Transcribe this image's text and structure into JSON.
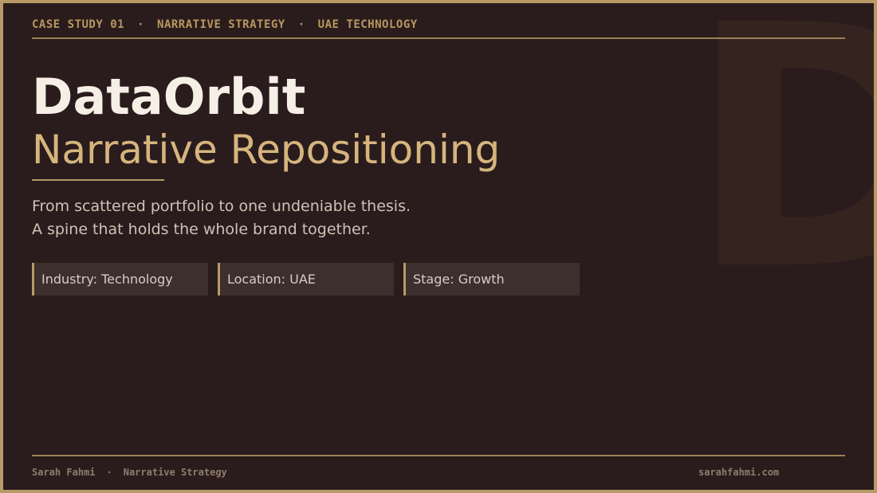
{
  "watermark": {
    "letter": "D"
  },
  "header": {
    "items": [
      "CASE STUDY 01",
      "NARRATIVE STRATEGY",
      "UAE TECHNOLOGY"
    ],
    "separator": "·"
  },
  "hero": {
    "title": "DataOrbit",
    "subtitle": "Narrative Repositioning",
    "tagline_lines": [
      "From scattered portfolio to one undeniable thesis.",
      "A spine that holds the whole brand together."
    ]
  },
  "tags": [
    "Industry: Technology",
    "Location: UAE",
    "Stage: Growth"
  ],
  "footer": {
    "author": "Sarah Fahmi",
    "separator": "·",
    "role": "Narrative Strategy",
    "website": "sarahfahmi.com"
  },
  "colors": {
    "background": "#2a1c1d",
    "accent_gold": "#b89a66",
    "title": "#f5efe6",
    "subtitle": "#d6b57d"
  }
}
